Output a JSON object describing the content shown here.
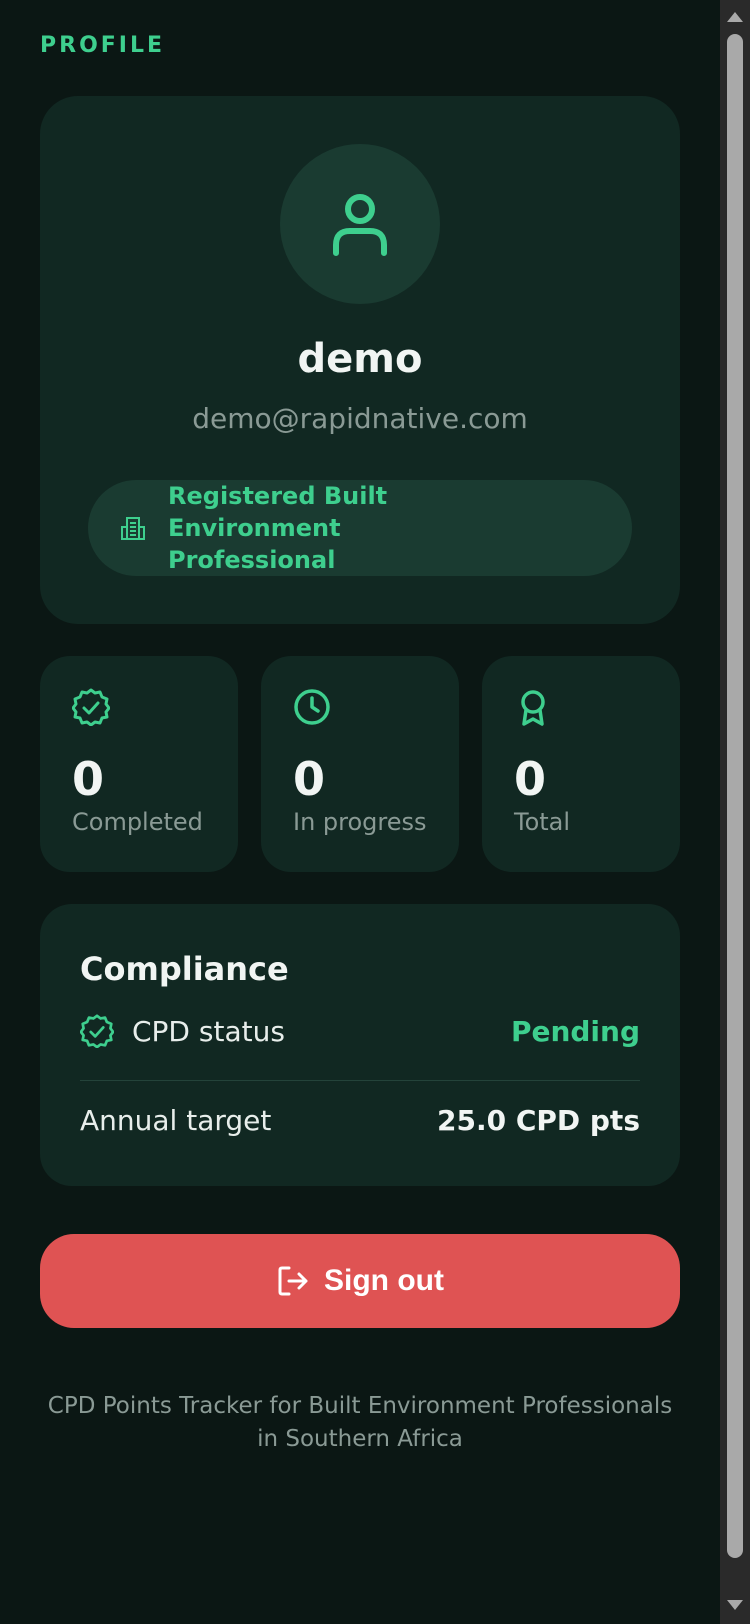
{
  "header": {
    "title": "PROFILE"
  },
  "profile": {
    "name": "demo",
    "email": "demo@rapidnative.com",
    "role_line1": "Registered Built Environment",
    "role_line2": "Professional"
  },
  "stats": [
    {
      "value": "0",
      "label": "Completed",
      "icon": "check-badge-icon"
    },
    {
      "value": "0",
      "label": "In progress",
      "icon": "clock-icon"
    },
    {
      "value": "0",
      "label": "Total",
      "icon": "award-icon"
    }
  ],
  "compliance": {
    "title": "Compliance",
    "status_label": "CPD status",
    "status_value": "Pending",
    "target_label": "Annual target",
    "target_value": "25.0 CPD pts"
  },
  "actions": {
    "signout_label": "Sign out"
  },
  "footer": {
    "line1": "CPD Points Tracker for Built Environment Professionals",
    "line2": "in Southern Africa"
  },
  "colors": {
    "accent": "#3ecf8e",
    "danger": "#df5353",
    "background": "#0b1714",
    "card": "#112822"
  }
}
